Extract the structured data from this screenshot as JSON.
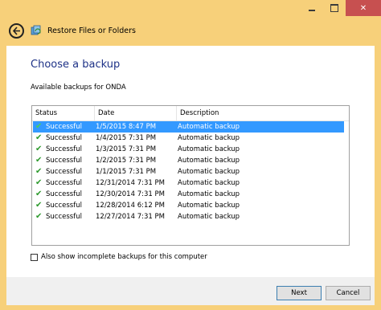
{
  "window": {
    "title": "Restore Files or Folders",
    "minimize_icon": "minimize-icon",
    "maximize_icon": "maximize-icon",
    "close_glyph": "✕",
    "accent": "#f7d07a",
    "close_color": "#c75050"
  },
  "nav": {
    "back_icon": "back-arrow-icon",
    "app_icon": "restore-files-icon"
  },
  "main": {
    "heading": "Choose a backup",
    "subheading": "Available backups for ONDA",
    "columns": [
      "Status",
      "Date",
      "Description"
    ],
    "rows": [
      {
        "status": "Successful",
        "date": "1/5/2015 8:47 PM",
        "description": "Automatic backup",
        "selected": true
      },
      {
        "status": "Successful",
        "date": "1/4/2015 7:31 PM",
        "description": "Automatic backup",
        "selected": false
      },
      {
        "status": "Successful",
        "date": "1/3/2015 7:31 PM",
        "description": "Automatic backup",
        "selected": false
      },
      {
        "status": "Successful",
        "date": "1/2/2015 7:31 PM",
        "description": "Automatic backup",
        "selected": false
      },
      {
        "status": "Successful",
        "date": "1/1/2015 7:31 PM",
        "description": "Automatic backup",
        "selected": false
      },
      {
        "status": "Successful",
        "date": "12/31/2014 7:31 PM",
        "description": "Automatic backup",
        "selected": false
      },
      {
        "status": "Successful",
        "date": "12/30/2014 7:31 PM",
        "description": "Automatic backup",
        "selected": false
      },
      {
        "status": "Successful",
        "date": "12/28/2014 6:12 PM",
        "description": "Automatic backup",
        "selected": false
      },
      {
        "status": "Successful",
        "date": "12/27/2014 7:31 PM",
        "description": "Automatic backup",
        "selected": false
      }
    ],
    "check_glyph": "✔",
    "show_incomplete_label": "Also show incomplete backups for this computer",
    "show_incomplete_checked": false,
    "selection_color": "#3399ff",
    "heading_color": "#1e3287"
  },
  "footer": {
    "next_label": "Next",
    "cancel_label": "Cancel"
  }
}
